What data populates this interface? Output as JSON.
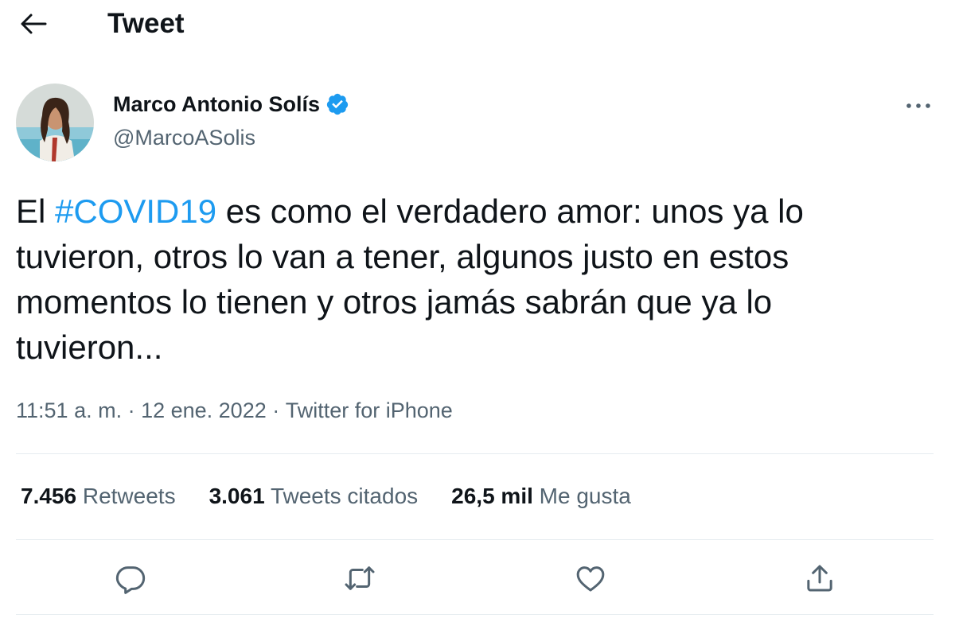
{
  "header": {
    "title": "Tweet",
    "back_icon": "back-arrow-icon"
  },
  "author": {
    "name": "Marco Antonio Solís",
    "handle": "@MarcoASolis",
    "verified": true,
    "verified_color": "#1d9bf0"
  },
  "tweet": {
    "text_before": "El ",
    "hashtag": "#COVID19",
    "text_after": " es como el verdadero amor: unos ya lo tuvieron, otros lo van a tener, algunos justo en estos momentos lo tienen y otros jamás sabrán que ya lo tuvieron...",
    "time": "11:51 a. m.",
    "separator": " · ",
    "date": "12 ene. 2022",
    "source": "Twitter for iPhone"
  },
  "stats": {
    "retweets_count": "7.456",
    "retweets_label": "Retweets",
    "quotes_count": "3.061",
    "quotes_label": "Tweets citados",
    "likes_count": "26,5 mil",
    "likes_label": "Me gusta"
  },
  "actions": {
    "reply": "reply-icon",
    "retweet": "retweet-icon",
    "like": "heart-icon",
    "share": "share-icon"
  },
  "colors": {
    "accent": "#1d9bf0",
    "text_primary": "#0f1419",
    "text_secondary": "#536471",
    "divider": "#e6ecf0"
  }
}
